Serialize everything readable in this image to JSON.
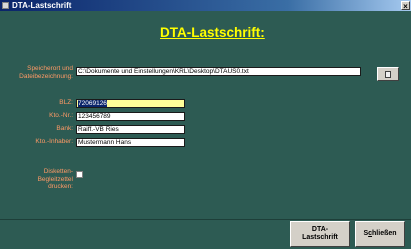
{
  "window": {
    "title": "DTA-Lastschrift",
    "close_glyph": "×"
  },
  "form": {
    "heading": "DTA-Lastschrift:",
    "storage": {
      "label": "Speicherort und Dateibezeichnung:",
      "value": "C:\\Dokumente und Einstellungen\\KRL\\Desktop\\DTAUS0.txt"
    },
    "blz": {
      "label": "BLZ:",
      "value": "72069126"
    },
    "account_no": {
      "label": "Kto.-Nr.:",
      "value": "123456789"
    },
    "bank": {
      "label": "Bank:",
      "value": "Raiff.-VB Ries"
    },
    "account_holder": {
      "label": "Kto.-Inhaber:",
      "value": "Mustermann Hans"
    },
    "print_slip": {
      "label": "Disketten-Begleitzettel drucken:",
      "checked": false
    }
  },
  "buttons": {
    "dta_line1": "DTA-",
    "dta_line2": "Lastschrift",
    "close_prefix": "S",
    "close_underlined": "c",
    "close_suffix": "hließen"
  },
  "colors": {
    "background": "#2d5b53",
    "title": "#ffff00",
    "labels": "#ff9a66",
    "active_field": "#ffff99"
  },
  "icons": {
    "browse": "folder-icon",
    "window": "app-icon"
  }
}
